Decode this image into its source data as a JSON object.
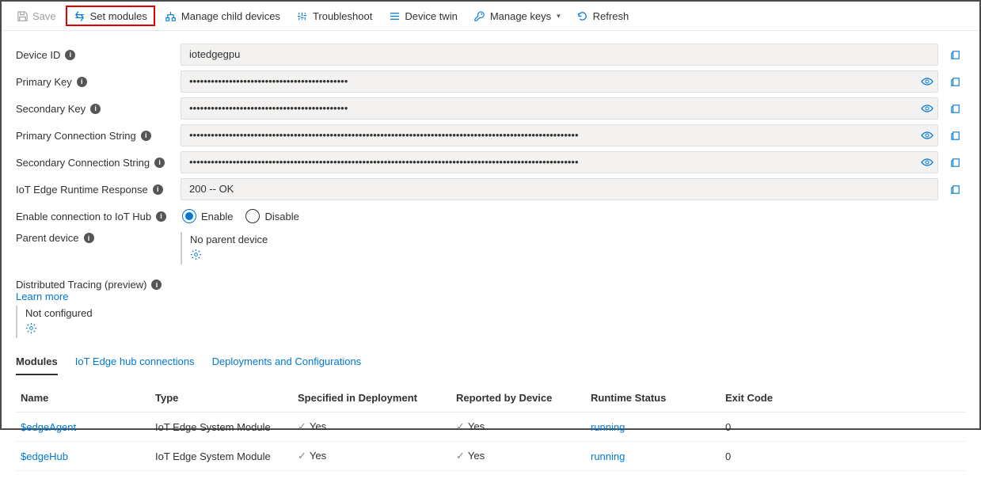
{
  "toolbar": {
    "save": "Save",
    "set_modules": "Set modules",
    "manage_child": "Manage child devices",
    "troubleshoot": "Troubleshoot",
    "device_twin": "Device twin",
    "manage_keys": "Manage keys",
    "refresh": "Refresh"
  },
  "form": {
    "device_id": {
      "label": "Device ID",
      "value": "iotedgegpu"
    },
    "primary_key": {
      "label": "Primary Key",
      "value": "••••••••••••••••••••••••••••••••••••••••••••"
    },
    "secondary_key": {
      "label": "Secondary Key",
      "value": "••••••••••••••••••••••••••••••••••••••••••••"
    },
    "primary_conn": {
      "label": "Primary Connection String",
      "value": "••••••••••••••••••••••••••••••••••••••••••••••••••••••••••••••••••••••••••••••••••••••••••••••••••••••••••••"
    },
    "secondary_conn": {
      "label": "Secondary Connection String",
      "value": "••••••••••••••••••••••••••••••••••••••••••••••••••••••••••••••••••••••••••••••••••••••••••••••••••••••••••••"
    },
    "runtime_resp": {
      "label": "IoT Edge Runtime Response",
      "value": "200 -- OK"
    },
    "enable_conn": {
      "label": "Enable connection to IoT Hub",
      "enable": "Enable",
      "disable": "Disable"
    },
    "parent": {
      "label": "Parent device",
      "value": "No parent device"
    },
    "dist_tracing": {
      "label": "Distributed Tracing (preview)",
      "learn_more": "Learn more",
      "status": "Not configured"
    }
  },
  "tabs": {
    "modules": "Modules",
    "hub_conn": "IoT Edge hub connections",
    "deployments": "Deployments and Configurations"
  },
  "table": {
    "headers": {
      "name": "Name",
      "type": "Type",
      "spec": "Specified in Deployment",
      "reported": "Reported by Device",
      "runtime": "Runtime Status",
      "exit": "Exit Code"
    },
    "rows": [
      {
        "name": "$edgeAgent",
        "type": "IoT Edge System Module",
        "spec": "Yes",
        "reported": "Yes",
        "runtime": "running",
        "exit": "0"
      },
      {
        "name": "$edgeHub",
        "type": "IoT Edge System Module",
        "spec": "Yes",
        "reported": "Yes",
        "runtime": "running",
        "exit": "0"
      }
    ]
  },
  "info_char": "i"
}
